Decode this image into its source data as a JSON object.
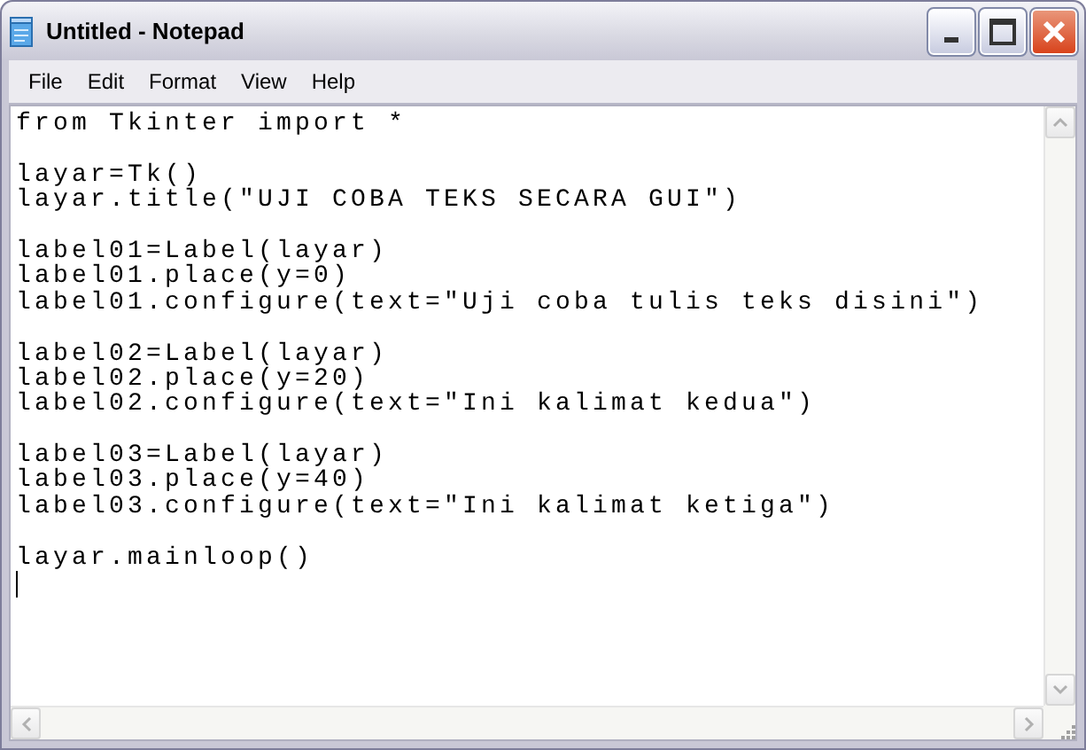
{
  "window": {
    "title": "Untitled - Notepad",
    "active": false
  },
  "menu": [
    "File",
    "Edit",
    "Format",
    "View",
    "Help"
  ],
  "editor": {
    "blocks": [
      [
        "from Tkinter import *"
      ],
      [
        "layar=Tk()",
        "layar.title(\"UJI COBA TEKS SECARA GUI\")"
      ],
      [
        "label01=Label(layar)",
        "label01.place(y=0)",
        "label01.configure(text=\"Uji coba tulis teks disini\")"
      ],
      [
        "label02=Label(layar)",
        "label02.place(y=20)",
        "label02.configure(text=\"Ini kalimat kedua\")"
      ],
      [
        "label03=Label(layar)",
        "label03.place(y=40)",
        "label03.configure(text=\"Ini kalimat ketiga\")"
      ],
      [
        "layar.mainloop()"
      ]
    ]
  }
}
